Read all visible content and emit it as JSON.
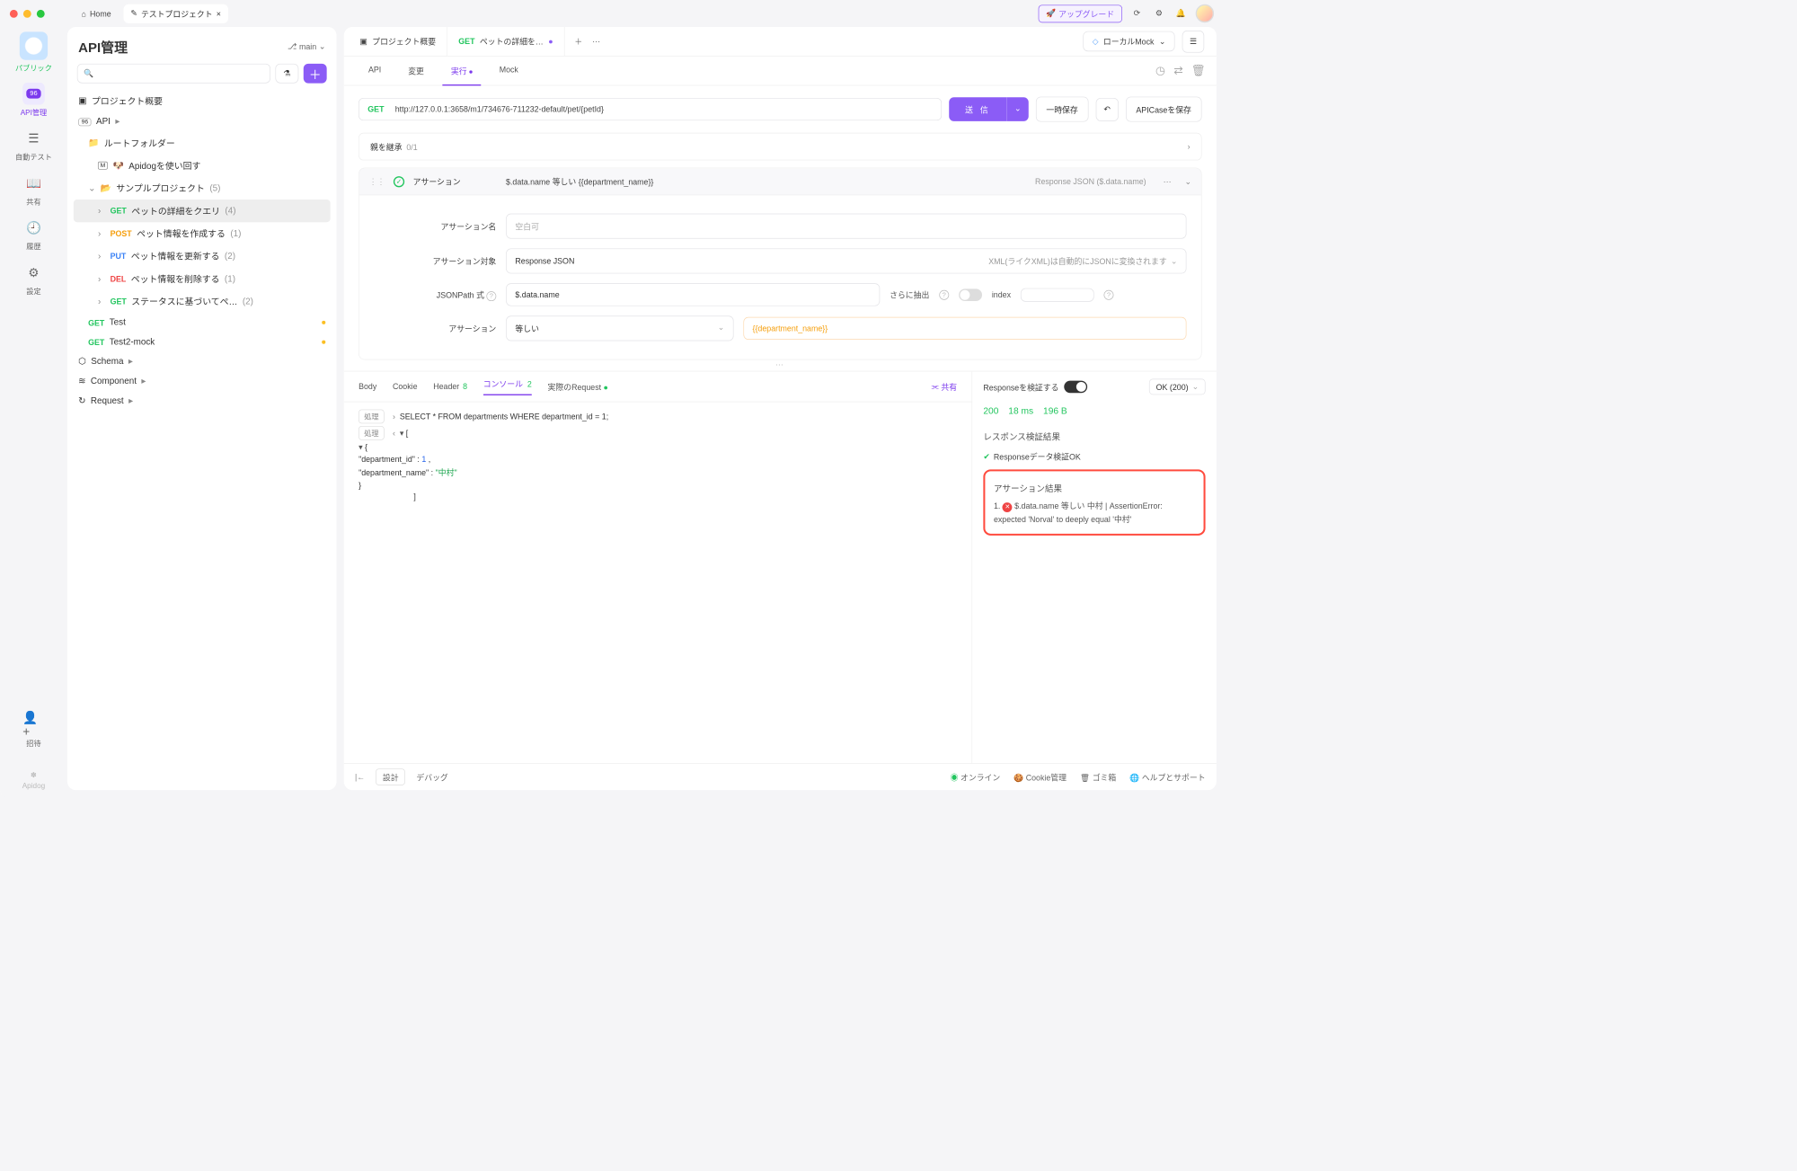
{
  "titlebar": {
    "home": "Home",
    "project_tab": "テストプロジェクト",
    "upgrade": "アップグレード"
  },
  "rail": {
    "public": "パブリック",
    "api": "API管理",
    "badge": "96",
    "autotest": "自動テスト",
    "share": "共有",
    "history": "履歴",
    "settings": "設定",
    "invite": "招待",
    "logo": "Apidog"
  },
  "sidebar": {
    "title": "API管理",
    "branch": "main",
    "overview": "プロジェクト概要",
    "api_root": "API",
    "root_folder": "ルートフォルダー",
    "apidog_reuse": "Apidogを使い回す",
    "sample_project": "サンプルプロジェクト",
    "sample_count": "(5)",
    "items": [
      {
        "method": "GET",
        "label": "ペットの詳細をクエリ",
        "count": "(4)",
        "selected": true
      },
      {
        "method": "POST",
        "label": "ペット情報を作成する",
        "count": "(1)"
      },
      {
        "method": "PUT",
        "label": "ペット情報を更新する",
        "count": "(2)"
      },
      {
        "method": "DEL",
        "label": "ペット情報を削除する",
        "count": "(1)"
      },
      {
        "method": "GET",
        "label": "ステータスに基づいてペ…",
        "count": "(2)"
      }
    ],
    "test1": {
      "method": "GET",
      "label": "Test"
    },
    "test2": {
      "method": "GET",
      "label": "Test2-mock"
    },
    "schema": "Schema",
    "component": "Component",
    "request": "Request"
  },
  "main_tabs": {
    "overview": "プロジェクト概要",
    "active_method": "GET",
    "active_label": "ペットの詳細を…",
    "env": "ローカルMock"
  },
  "subtabs": {
    "api": "API",
    "change": "変更",
    "run": "実行",
    "mock": "Mock"
  },
  "request": {
    "method": "GET",
    "url": "http://127.0.0.1:3658/m1/734676-711232-default/pet/{petId}",
    "send": "送 信",
    "save_temp": "一時保存",
    "save_case": "APICaseを保存"
  },
  "inherit": {
    "label": "親を継承",
    "count": "0/1"
  },
  "assertion": {
    "title": "アサーション",
    "expr": "$.data.name 等しい {{department_name}}",
    "hint": "Response JSON ($.data.name)",
    "name_label": "アサーション名",
    "name_placeholder": "空白可",
    "target_label": "アサーション対象",
    "target_value": "Response JSON",
    "xml_hint": "XML(ライクXML)は自動的にJSONに変換されます",
    "jsonpath_label": "JSONPath 式",
    "jsonpath_value": "$.data.name",
    "extract_more": "さらに抽出",
    "index_label": "index",
    "op_label": "アサーション",
    "op_value": "等しい",
    "expected_value": "{{department_name}}"
  },
  "resp_tabs": {
    "body": "Body",
    "cookie": "Cookie",
    "header": "Header",
    "header_count": "8",
    "console": "コンソール",
    "console_count": "2",
    "actual": "実際のRequest",
    "share": "共有"
  },
  "console": {
    "chip": "処理",
    "sql": "SELECT * FROM departments WHERE department_id = 1;",
    "dept_id_key": "\"department_id\"",
    "dept_id_val": "1",
    "dept_name_key": "\"department_name\"",
    "dept_name_val": "\"中村\""
  },
  "resp_right": {
    "validate_label": "Responseを検証する",
    "status_label": "OK (200)",
    "stats": {
      "code": "200",
      "time": "18 ms",
      "size": "196 B"
    },
    "result_title": "レスポンス検証結果",
    "result_ok": "Responseデータ検証OK",
    "assert_title": "アサーション結果",
    "assert_err": "1.  $.data.name 等しい 中村 | AssertionError: expected 'Norval' to deeply equal '中村'"
  },
  "footer": {
    "design": "設計",
    "debug": "デバッグ",
    "online": "オンライン",
    "cookie": "Cookie管理",
    "trash": "ゴミ箱",
    "help": "ヘルプとサポート"
  }
}
